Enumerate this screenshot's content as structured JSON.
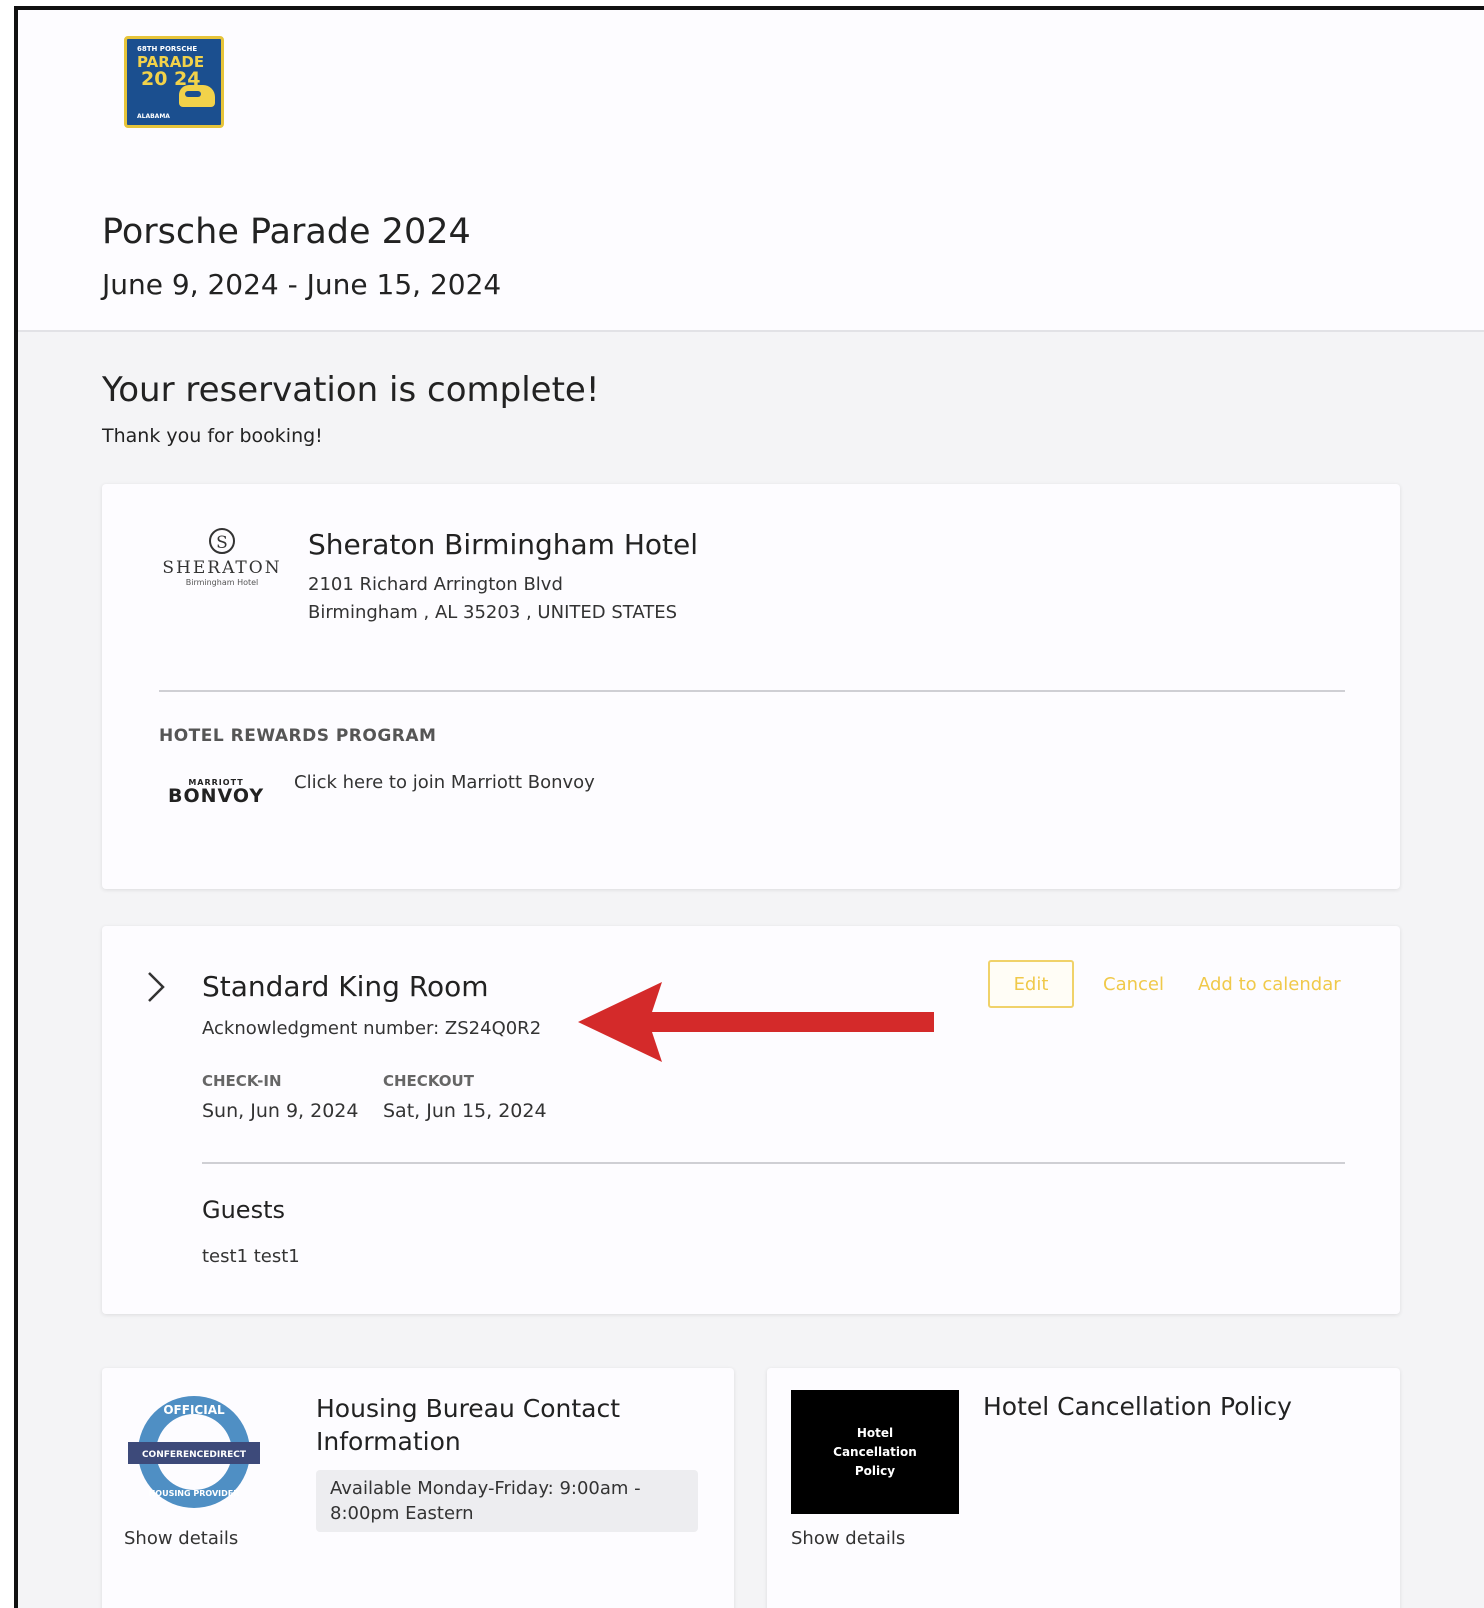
{
  "header": {
    "logo_top": "68TH PORSCHE",
    "logo_main": "PARADE",
    "logo_year": "20 24",
    "logo_state": "ALABAMA"
  },
  "event": {
    "title": "Porsche Parade 2024",
    "dates": "June 9, 2024 - June 15, 2024"
  },
  "confirmation": {
    "title": "Your reservation is complete!",
    "subtitle": "Thank you for booking!"
  },
  "hotel": {
    "logo_word": "SHERATON",
    "logo_emblem": "S",
    "logo_sub": "Birmingham Hotel",
    "name": "Sheraton Birmingham Hotel",
    "address_line1": "2101 Richard Arrington Blvd",
    "address_line2": "Birmingham , AL 35203 , UNITED STATES",
    "rewards_label": "HOTEL REWARDS PROGRAM",
    "rewards_logo_top": "MARRIOTT",
    "rewards_logo_main": "BONVOY",
    "rewards_link": "Click here to join Marriott Bonvoy"
  },
  "room": {
    "name": "Standard King Room",
    "acknowledgment": "Acknowledgment number: ZS24Q0R2",
    "edit_label": "Edit",
    "cancel_label": "Cancel",
    "calendar_label": "Add to calendar",
    "checkin_label": "CHECK-IN",
    "checkin_value": "Sun, Jun 9, 2024",
    "checkout_label": "CHECKOUT",
    "checkout_value": "Sat, Jun 15, 2024",
    "guests_label": "Guests",
    "guests_value": "test1 test1"
  },
  "bureau": {
    "logo_text_top": "OFFICIAL",
    "logo_text_band": "CONFERENCEDIRECT",
    "logo_text_bottom": "HOUSING PROVIDER",
    "title": "Housing Bureau Contact Information",
    "hours": "Available Monday-Friday: 9:00am - 8:00pm Eastern",
    "show_details": "Show details"
  },
  "policy": {
    "image_text": "Hotel Cancellation Policy",
    "title": "Hotel Cancellation Policy",
    "show_details": "Show details"
  },
  "colors": {
    "accent": "#f0c94a",
    "arrow": "#d42a2a",
    "logo_blue": "#1b4f8f"
  },
  "icons": {
    "chevron": "chevron-right-icon",
    "annotation": "red-arrow-icon"
  }
}
